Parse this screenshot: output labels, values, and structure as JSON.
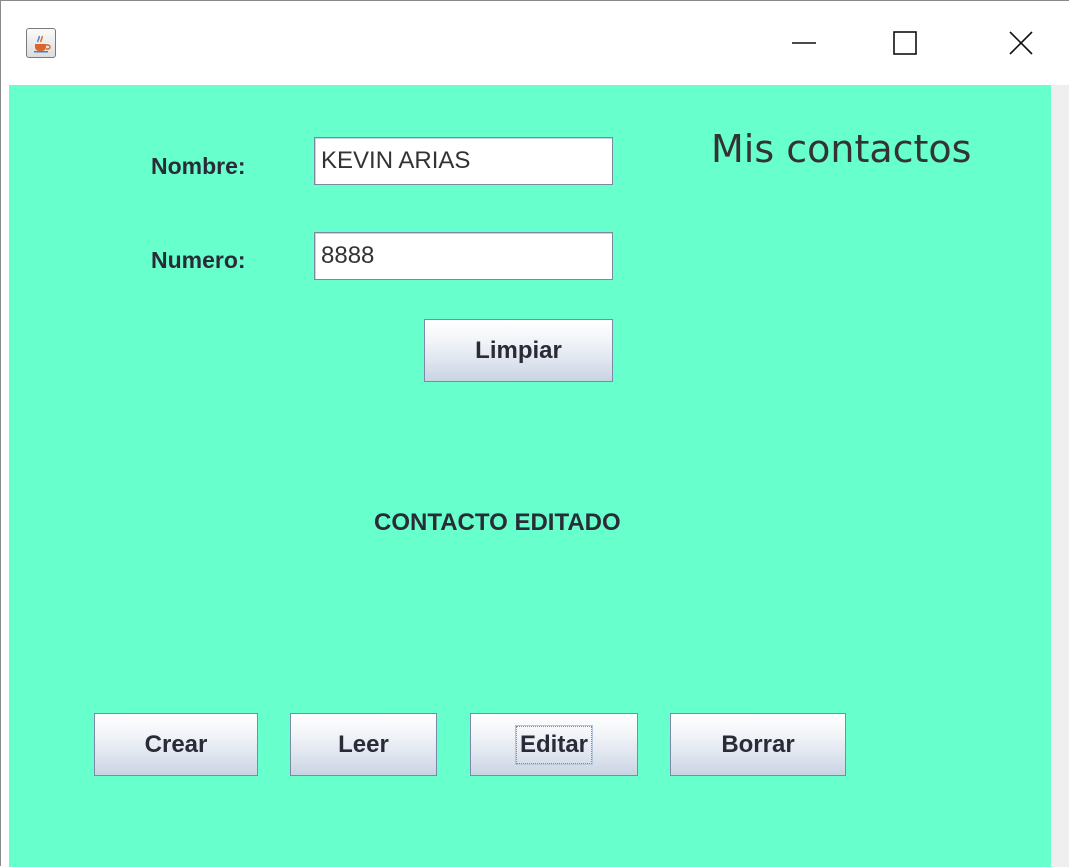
{
  "window": {
    "icon": "java-cup-icon",
    "controls": {
      "minimize": "minimize-icon",
      "maximize": "maximize-icon",
      "close": "close-icon"
    }
  },
  "colors": {
    "background": "#67ffcb",
    "text": "#2b2b38"
  },
  "form": {
    "title": "Mis contactos",
    "nombre_label": "Nombre:",
    "nombre_value": "KEVIN ARIAS",
    "numero_label": "Numero:",
    "numero_value": "8888",
    "limpiar_label": "Limpiar"
  },
  "status": {
    "message": "CONTACTO EDITADO"
  },
  "actions": {
    "crear": "Crear",
    "leer": "Leer",
    "editar": "Editar",
    "borrar": "Borrar"
  }
}
